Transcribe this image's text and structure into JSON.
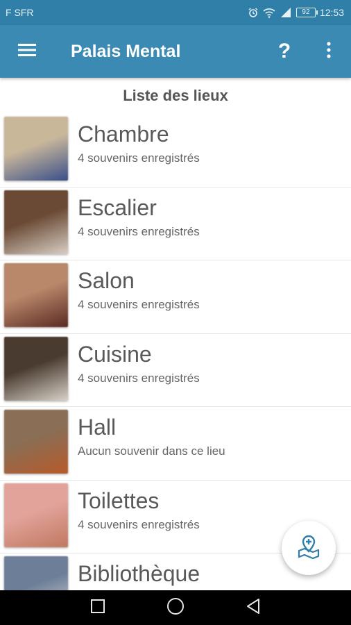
{
  "status_bar": {
    "carrier": "F SFR",
    "battery": "92",
    "time": "12:53",
    "icons": [
      "alarm-icon",
      "wifi-icon",
      "signal-icon",
      "battery-icon"
    ]
  },
  "app_bar": {
    "title": "Palais Mental",
    "help_label": "?",
    "menu_icon": "menu-icon",
    "more_icon": "more-vert-icon"
  },
  "list": {
    "header": "Liste des lieux",
    "places": [
      {
        "name": "Chambre",
        "subtitle": "4 souvenirs enregistrés",
        "thumb_colors": [
          "#c9b79a",
          "#3a4f8a"
        ]
      },
      {
        "name": "Escalier",
        "subtitle": "4 souvenirs enregistrés",
        "thumb_colors": [
          "#6b4a35",
          "#d8cfc4"
        ]
      },
      {
        "name": "Salon",
        "subtitle": "4 souvenirs enregistrés",
        "thumb_colors": [
          "#b9876a",
          "#5a2a22"
        ]
      },
      {
        "name": "Cuisine",
        "subtitle": "4 souvenirs enregistrés",
        "thumb_colors": [
          "#4a3b30",
          "#d8d2c8"
        ]
      },
      {
        "name": "Hall",
        "subtitle": "Aucun souvenir dans ce lieu",
        "thumb_colors": [
          "#8a6e55",
          "#b85a2a"
        ]
      },
      {
        "name": "Toilettes",
        "subtitle": "4 souvenirs enregistrés",
        "thumb_colors": [
          "#e2a39a",
          "#c07860"
        ]
      },
      {
        "name": "Bibliothèque",
        "subtitle": "",
        "thumb_colors": [
          "#6d7f98",
          "#d9d9e0"
        ]
      }
    ]
  },
  "fab": {
    "icon": "add-location-icon",
    "color": "#2f7fa8"
  },
  "nav_bar": {
    "icons": [
      "recent-apps-icon",
      "home-icon",
      "back-icon"
    ]
  },
  "colors": {
    "primary": "#3a8ab3",
    "status": "#2f7fa8"
  }
}
